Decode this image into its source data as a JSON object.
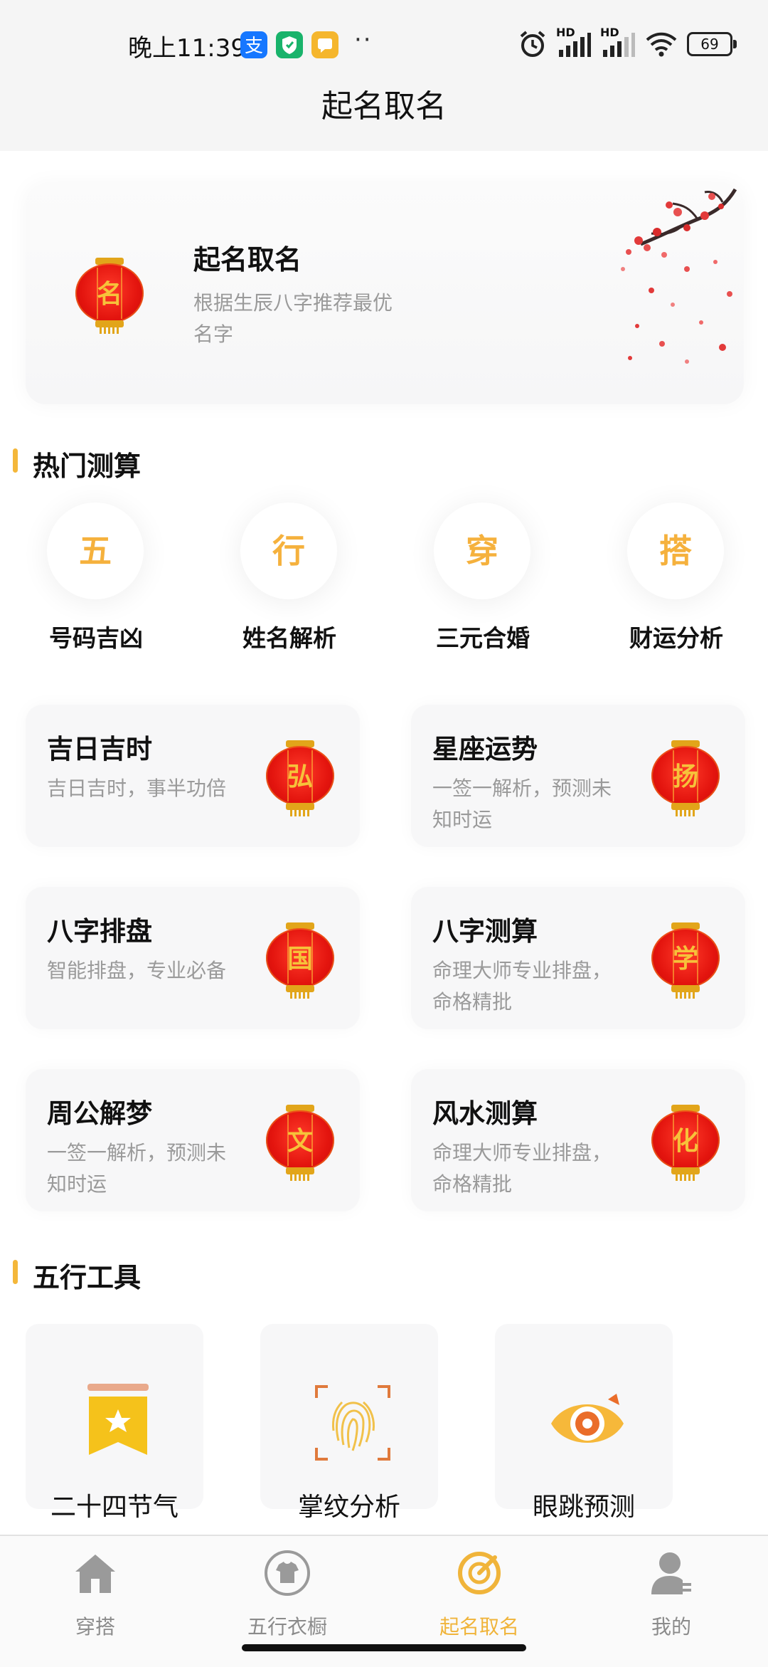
{
  "status_bar": {
    "time": "晚上11:39",
    "signal_1": "HD",
    "signal_2": "HD",
    "battery": "69",
    "icons": [
      "alipay-icon",
      "shield-icon",
      "chat-icon",
      "more-dots-icon",
      "alarm-icon",
      "signal-icon",
      "wifi-icon",
      "battery-icon"
    ]
  },
  "header": {
    "title": "起名取名"
  },
  "banner": {
    "title": "起名取名",
    "desc": "根据生辰八字推荐最优名字",
    "lantern_char": "名"
  },
  "hot_section": {
    "title": "热门测算",
    "items": [
      {
        "char": "五",
        "label": "号码吉凶"
      },
      {
        "char": "行",
        "label": "姓名解析"
      },
      {
        "char": "穿",
        "label": "三元合婚"
      },
      {
        "char": "搭",
        "label": "财运分析"
      }
    ]
  },
  "cards": [
    {
      "title": "吉日吉时",
      "desc": "吉日吉时，事半功倍",
      "lantern_char": "弘"
    },
    {
      "title": "星座运势",
      "desc": "一签一解析，预测未知时运",
      "lantern_char": "扬"
    },
    {
      "title": "八字排盘",
      "desc": "智能排盘，专业必备",
      "lantern_char": "国"
    },
    {
      "title": "八字测算",
      "desc": "命理大师专业排盘，命格精批",
      "lantern_char": "学"
    },
    {
      "title": "周公解梦",
      "desc": "一签一解析，预测未知时运",
      "lantern_char": "文"
    },
    {
      "title": "风水测算",
      "desc": "命理大师专业排盘，命格精批",
      "lantern_char": "化"
    }
  ],
  "tools_section": {
    "title": "五行工具",
    "items": [
      {
        "label": "二十四节气",
        "icon": "solar-terms-icon"
      },
      {
        "label": "掌纹分析",
        "icon": "fingerprint-icon"
      },
      {
        "label": "眼跳预测",
        "icon": "eye-icon"
      }
    ]
  },
  "bottom_nav": {
    "items": [
      {
        "label": "穿搭",
        "icon": "home-icon"
      },
      {
        "label": "五行衣橱",
        "icon": "wardrobe-icon"
      },
      {
        "label": "起名取名",
        "icon": "naming-icon",
        "active": true
      },
      {
        "label": "我的",
        "icon": "profile-icon"
      }
    ]
  },
  "colors": {
    "accent": "#f0b43a",
    "lantern_red": "#e3140e",
    "muted_text": "#9a9a9a",
    "nav_inactive": "#8b8b8b"
  }
}
